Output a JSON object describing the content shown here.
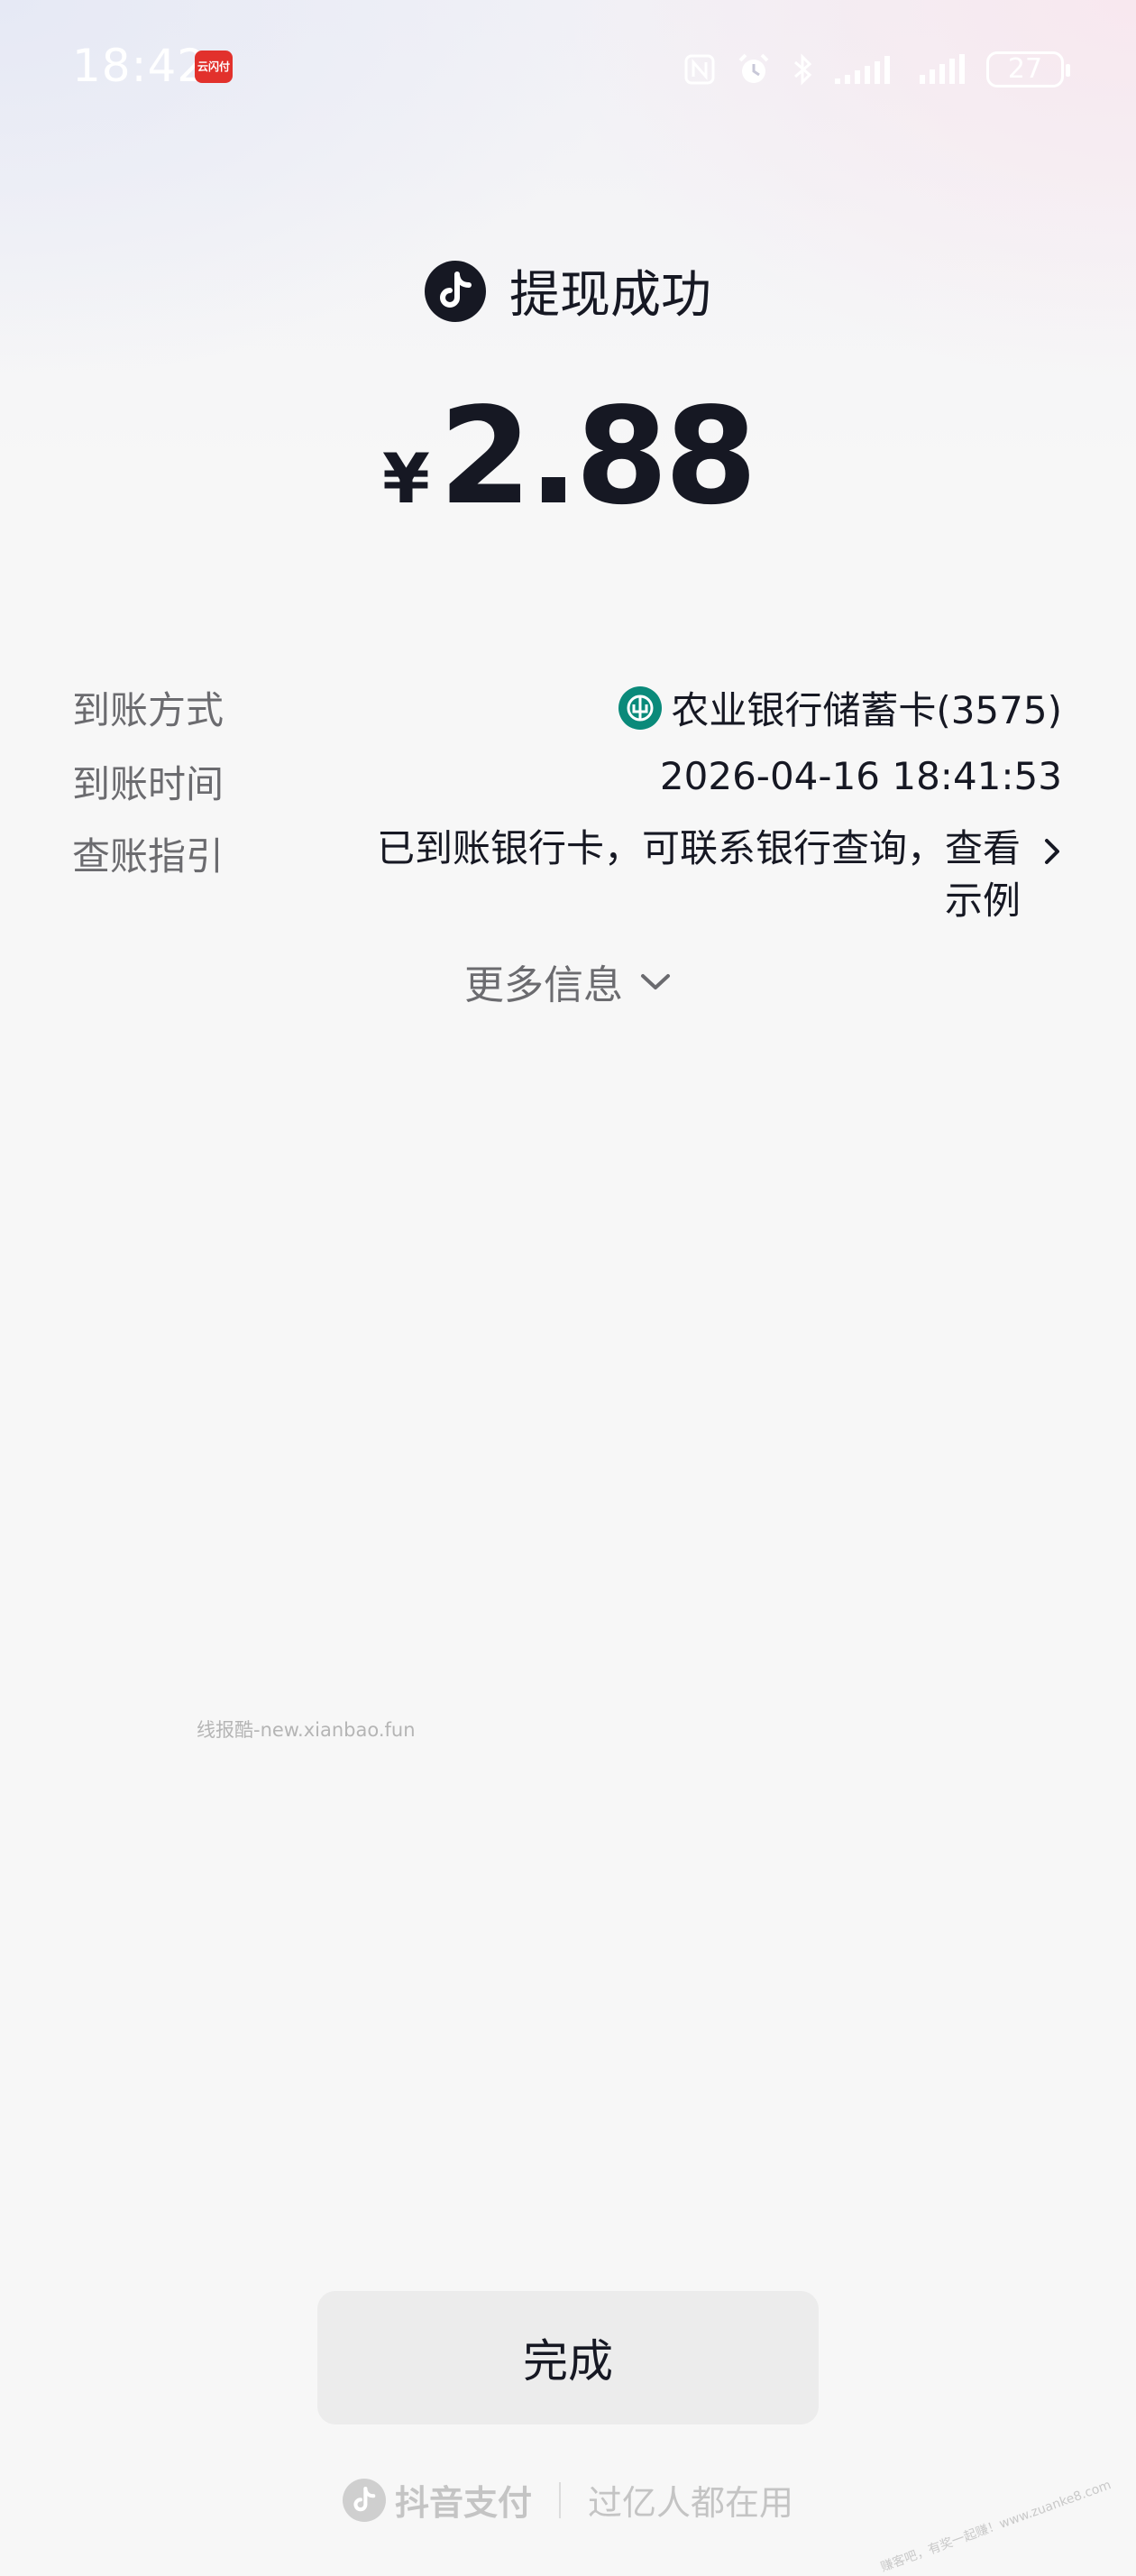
{
  "status_bar": {
    "time": "18:42",
    "app_icon_label": "云闪付",
    "icons": [
      "nfc-icon",
      "alarm-icon",
      "bluetooth-icon",
      "signal-icon",
      "signal-icon"
    ],
    "battery": "27"
  },
  "result": {
    "title": "提现成功",
    "currency": "¥",
    "amount": "2.88"
  },
  "details": {
    "method_label": "到账方式",
    "method_value": "农业银行储蓄卡(3575)",
    "time_label": "到账时间",
    "time_value": "2026-04-16 18:41:53",
    "guide_label": "查账指引",
    "guide_value": "已到账银行卡，可联系银行查询，查看示例"
  },
  "more_info": "更多信息",
  "watermark": "线报酷-new.xianbao.fun",
  "done_button": "完成",
  "footer": {
    "brand": "抖音支付",
    "slogan": "过亿人都在用"
  },
  "corner_watermark": "赚客吧，有奖一起赚！www.zuanke8.com",
  "colors": {
    "background": "#f7f7f7",
    "text_primary": "#161823",
    "text_secondary": "#6b6b6f",
    "bank_green": "#0a8a7a",
    "button_bg": "#ececec"
  }
}
